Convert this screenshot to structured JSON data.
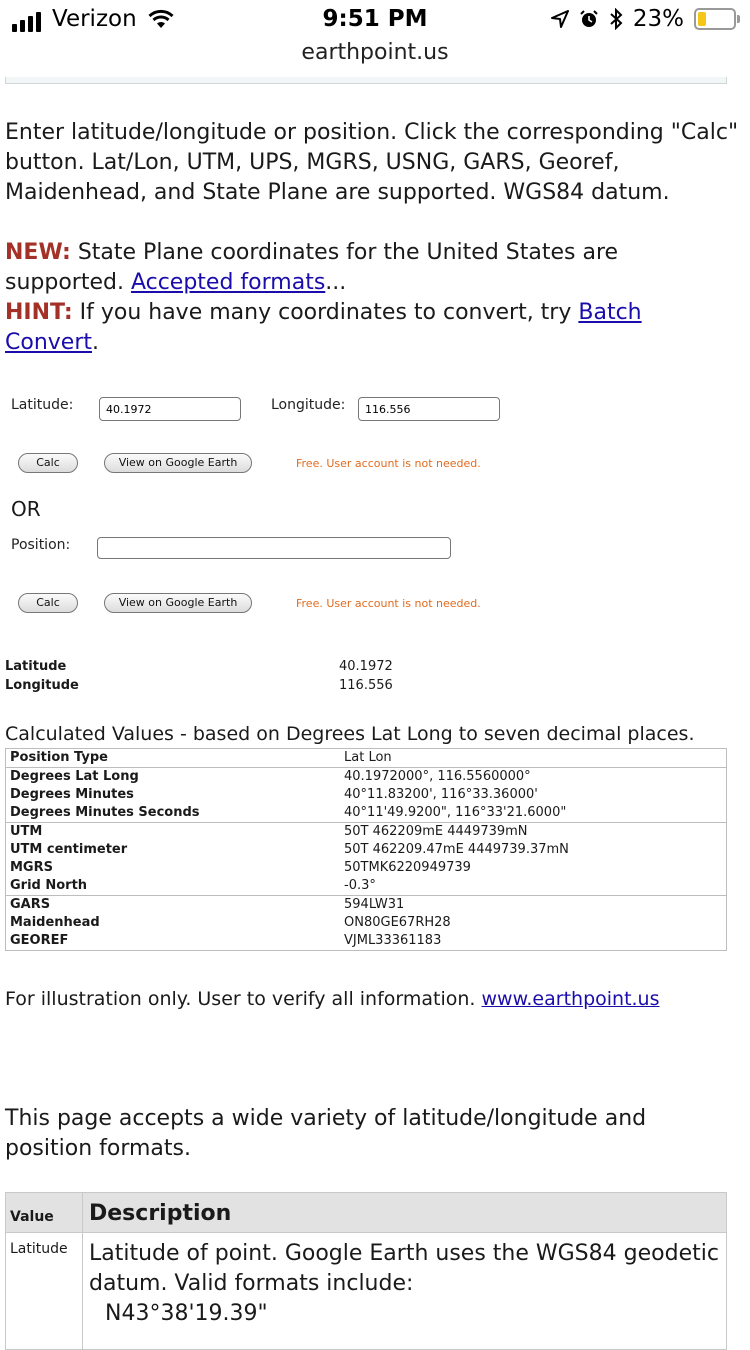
{
  "status_bar": {
    "carrier": "Verizon",
    "time": "9:51 PM",
    "battery": "23%",
    "battery_level": 0.23,
    "url": "earthpoint.us"
  },
  "intro": "Enter latitude/longitude or position.  Click the corresponding \"Calc\" button.  Lat/Lon, UTM, UPS, MGRS, USNG, GARS, Georef, Maidenhead, and State Plane are supported.  WGS84 datum.",
  "news": {
    "new_label": "NEW:",
    "new_text": " State Plane coordinates for the United States are supported.  ",
    "formats_link": "Accepted formats",
    "ellipsis": "...",
    "hint_label": "HINT:",
    "hint_text": " If you have many coordinates to convert, try ",
    "batch_link": "Batch Convert",
    "period": "."
  },
  "form": {
    "latitude_label": "Latitude:",
    "latitude_value": "40.1972",
    "longitude_label": "Longitude:",
    "longitude_value": "116.556",
    "calc_label": "Calc",
    "view_label": "View on Google Earth",
    "free_note": "Free. User account is not needed.",
    "or_label": "OR",
    "position_label": "Position:",
    "position_value": ""
  },
  "summary": [
    {
      "key": "Latitude",
      "value": "40.1972"
    },
    {
      "key": "Longitude",
      "value": "116.556"
    }
  ],
  "calculated": {
    "title": "Calculated Values - based on Degrees Lat Long to seven decimal places.",
    "rows": [
      {
        "key": "Position Type",
        "value": "Lat Lon"
      },
      {
        "key": "Degrees Lat Long",
        "value": "40.1972000°, 116.5560000°"
      },
      {
        "key": "Degrees Minutes",
        "value": "40°11.83200', 116°33.36000'"
      },
      {
        "key": "Degrees Minutes Seconds",
        "value": "40°11'49.9200\", 116°33'21.6000\""
      },
      {
        "key": "UTM",
        "value": "50T 462209mE 4449739mN"
      },
      {
        "key": "UTM centimeter",
        "value": "50T 462209.47mE 4449739.37mN"
      },
      {
        "key": "MGRS",
        "value": "50TMK6220949739"
      },
      {
        "key": "Grid North",
        "value": "-0.3°"
      },
      {
        "key": "GARS",
        "value": "594LW31"
      },
      {
        "key": "Maidenhead",
        "value": "ON80GE67RH28"
      },
      {
        "key": "GEOREF",
        "value": "VJML33361183"
      }
    ]
  },
  "illustration": {
    "text": "For illustration only.  User to verify all information. ",
    "link": "www.earthpoint.us"
  },
  "accepts_text": "This page accepts a wide variety of latitude/longitude and position formats.",
  "desc_table": {
    "value_header": "Value",
    "description_header": "Description",
    "row_value": "Latitude",
    "row_description": "Latitude of point.  Google Earth uses the WGS84 geodetic datum.  Valid formats include:",
    "row_example": "N43°38'19.39\""
  }
}
